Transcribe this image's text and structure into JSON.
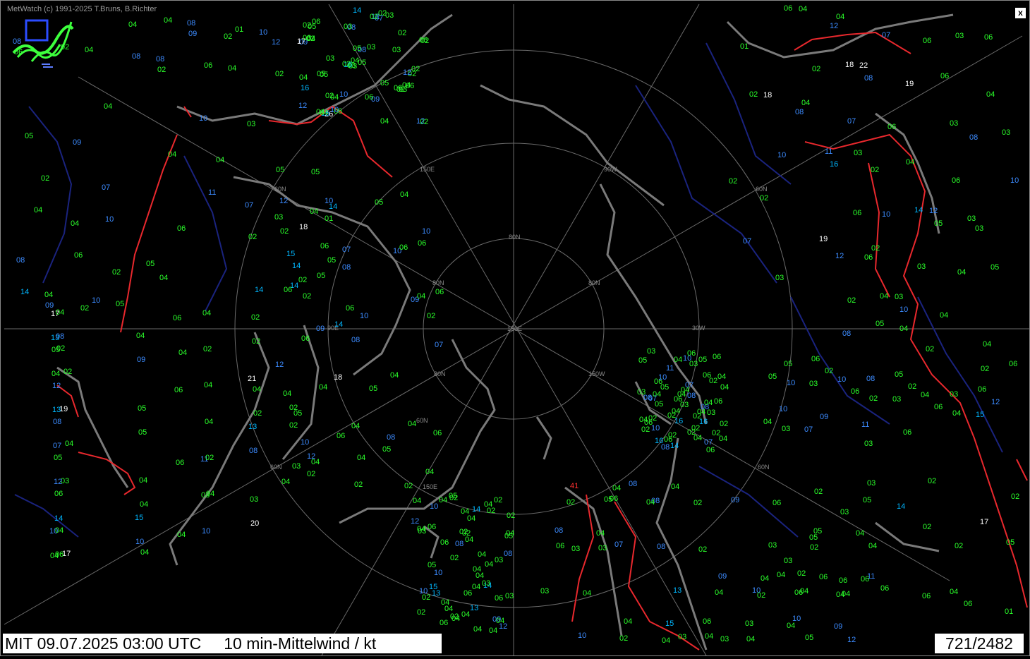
{
  "header": {
    "credit": "MetWatch  (c) 1991-2025 T.Bruns, B.Richter",
    "close_label": "x"
  },
  "footer": {
    "title": "MIT 09.07.2025 03:00 UTC     10 min-Mittelwind / kt",
    "counter": "721/2482"
  },
  "grid_labels": [
    "60N",
    "60N",
    "60N",
    "60N",
    "60N",
    "80N",
    "80N",
    "80N",
    "80N",
    "150W",
    "150E",
    "90W",
    "90E",
    "30W",
    "150E"
  ],
  "station_values": [
    "14",
    "19",
    "10",
    "16",
    "04",
    "10",
    "08",
    "02",
    "06",
    "04",
    "10",
    "10",
    "18",
    "06",
    "04",
    "05",
    "02",
    "04",
    "11",
    "21",
    "14",
    "12",
    "03",
    "06",
    "03",
    "13",
    "07",
    "15",
    "11",
    "02",
    "04",
    "07",
    "10",
    "26",
    "05",
    "04",
    "14",
    "15",
    "10",
    "07",
    "06",
    "03",
    "05",
    "13",
    "10",
    "09",
    "04",
    "04",
    "03",
    "05",
    "07",
    "09",
    "06",
    "05",
    "04",
    "06",
    "14",
    "07",
    "05",
    "13",
    "06",
    "04",
    "06",
    "08",
    "17",
    "14",
    "10",
    "11",
    "06",
    "08",
    "02",
    "08",
    "12",
    "10",
    "09",
    "06",
    "04",
    "04",
    "09",
    "05",
    "06",
    "10",
    "03",
    "06",
    "03",
    "04",
    "03",
    "07",
    "14",
    "07",
    "10",
    "13",
    "06",
    "02",
    "05",
    "04",
    "03",
    "02",
    "05",
    "05",
    "13",
    "07",
    "11",
    "09",
    "03",
    "03",
    "02",
    "11",
    "05",
    "03",
    "02",
    "08",
    "10",
    "03",
    "05",
    "09",
    "06",
    "03",
    "05",
    "04",
    "04",
    "09",
    "08",
    "02",
    "14",
    "05",
    "04",
    "08",
    "05",
    "02",
    "03",
    "04",
    "05",
    "04",
    "05",
    "02",
    "10",
    "06",
    "04",
    "15",
    "05",
    "17",
    "06",
    "08",
    "04",
    "04",
    "08",
    "10",
    "05",
    "09",
    "14",
    "08",
    "14",
    "09",
    "04",
    "18",
    "05",
    "10",
    "05",
    "03",
    "04",
    "04",
    "08",
    "06",
    "04",
    "07",
    "02",
    "05",
    "02",
    "12",
    "06",
    "04",
    "12",
    "03",
    "02",
    "10",
    "08",
    "04",
    "02",
    "03",
    "10",
    "09",
    "10",
    "06",
    "11",
    "06",
    "03",
    "03",
    "02",
    "05",
    "04",
    "05",
    "03",
    "06",
    "04",
    "03",
    "03",
    "02",
    "01",
    "03",
    "06",
    "08",
    "17",
    "05",
    "10",
    "02",
    "03",
    "07",
    "13",
    "10",
    "22",
    "01",
    "09",
    "15",
    "15",
    "07",
    "10",
    "17",
    "08",
    "10",
    "06",
    "02",
    "02",
    "05",
    "10",
    "09",
    "08",
    "07",
    "14",
    "12",
    "06",
    "04",
    "03",
    "16",
    "06",
    "20",
    "18",
    "19",
    "04",
    "08",
    "10",
    "12",
    "10",
    "14",
    "02",
    "04",
    "02",
    "03",
    "06",
    "02",
    "04",
    "02",
    "04",
    "05",
    "01",
    "02",
    "06",
    "41",
    "03",
    "04",
    "03",
    "06",
    "07",
    "09",
    "02",
    "06",
    "08",
    "12",
    "03",
    "04",
    "08",
    "06",
    "05",
    "03",
    "03",
    "04",
    "06",
    "04",
    "02",
    "02",
    "05",
    "04",
    "06",
    "03",
    "03",
    "02",
    "04",
    "02",
    "02",
    "05",
    "05",
    "06",
    "03",
    "04",
    "05",
    "04",
    "02",
    "04",
    "04",
    "04",
    "01",
    "06",
    "03",
    "04",
    "06",
    "02",
    "02",
    "02",
    "04",
    "12",
    "14",
    "15",
    "06",
    "08",
    "16",
    "07",
    "12",
    "12",
    "03",
    "06",
    "04",
    "02",
    "02",
    "04",
    "04",
    "02",
    "05",
    "05",
    "02",
    "02",
    "03",
    "04",
    "06",
    "04",
    "06",
    "04",
    "03",
    "02",
    "04",
    "05",
    "04",
    "04",
    "06",
    "02",
    "04",
    "04",
    "02",
    "04",
    "03",
    "10",
    "04",
    "02",
    "04",
    "06",
    "04",
    "03",
    "04",
    "02",
    "02",
    "16",
    "08",
    "04",
    "02",
    "02",
    "04",
    "04",
    "12",
    "04",
    "02",
    "02",
    "14",
    "02",
    "18",
    "06",
    "12",
    "16",
    "10",
    "04",
    "08",
    "04",
    "12",
    "06",
    "02",
    "02",
    "02",
    "04",
    "02",
    "04",
    "04",
    "04",
    "19",
    "08",
    "04",
    "12",
    "10",
    "08",
    "06",
    "04",
    "04",
    "04",
    "02",
    "03",
    "12",
    "02",
    "06",
    "05",
    "02",
    "03",
    "03",
    "05",
    "03",
    "06",
    "04",
    "06",
    "06",
    "04",
    "05",
    "06",
    "02",
    "04",
    "02",
    "04",
    "04",
    "04",
    "06",
    "02",
    "12",
    "06",
    "06",
    "06",
    "04",
    "04",
    "04",
    "04",
    "08",
    "08",
    "08",
    "04",
    "06",
    "06",
    "03",
    "02",
    "04",
    "06",
    "06",
    "02",
    "06",
    "02",
    "04",
    "06",
    "05",
    "02",
    "06",
    "03",
    "10",
    "02",
    "04",
    "04",
    "04",
    "02",
    "04",
    "06",
    "06",
    "02",
    "04",
    "02",
    "04",
    "04",
    "02",
    "04",
    "02",
    "10",
    "04",
    "04",
    "02",
    "04",
    "08",
    "16",
    "08",
    "02",
    "04",
    "02",
    "02",
    "04",
    "06",
    "02",
    "04",
    "04",
    "02",
    "04",
    "02",
    "02",
    "04",
    "04",
    "03",
    "12",
    "02",
    "04",
    "03",
    "05",
    "04"
  ]
}
